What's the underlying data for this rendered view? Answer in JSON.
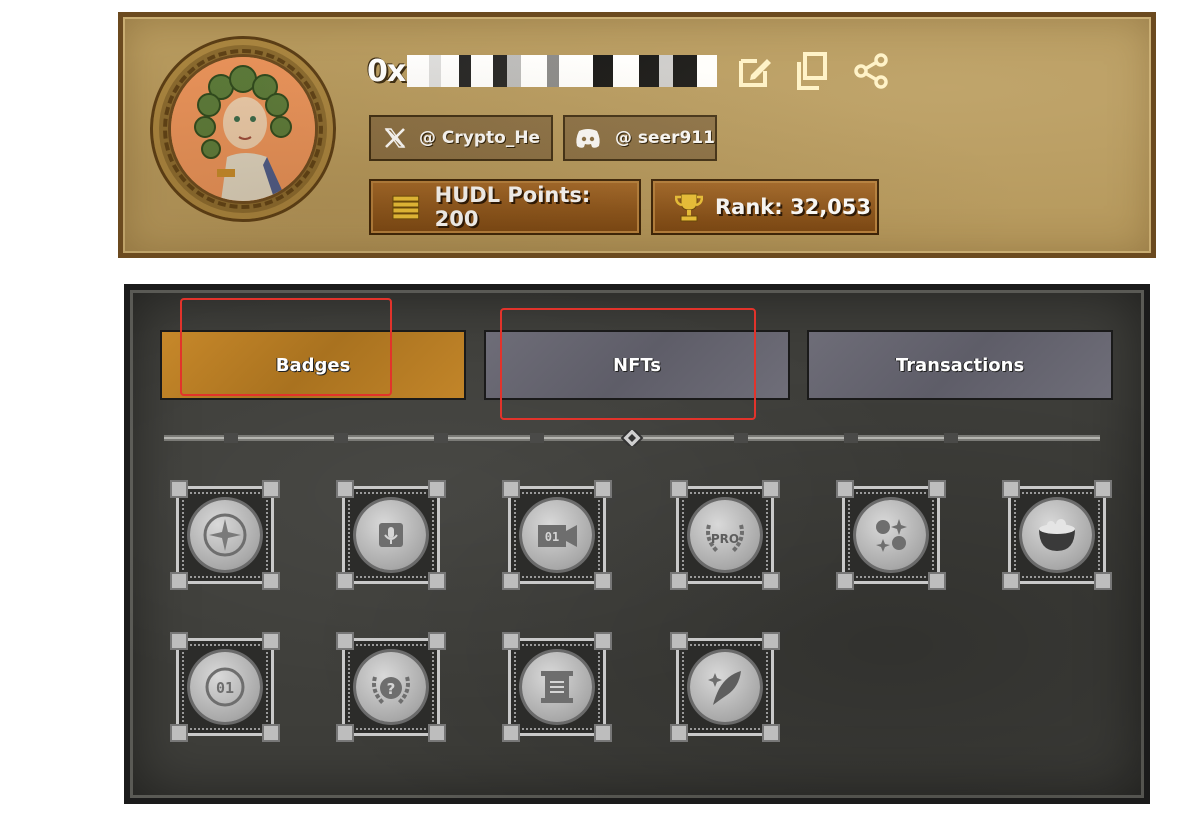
{
  "profile": {
    "address_prefix": "0x",
    "social": [
      {
        "platform": "x",
        "icon": "x-logo-icon",
        "handle": "@ Crypto_He"
      },
      {
        "platform": "discord",
        "icon": "discord-icon",
        "handle": "@ seer911"
      }
    ],
    "stats": [
      {
        "icon": "coins-stack-icon",
        "label": "HUDL Points: 200"
      },
      {
        "icon": "trophy-icon",
        "label": "Rank: 32,053"
      }
    ]
  },
  "tabs": [
    {
      "label": "Badges",
      "active": true
    },
    {
      "label": "NFTs",
      "active": false
    },
    {
      "label": "Transactions",
      "active": false
    }
  ],
  "badges": [
    {
      "icon": "sparkle-badge-icon"
    },
    {
      "icon": "microphone-badge-icon"
    },
    {
      "icon": "video-camera-badge-icon",
      "text": "01"
    },
    {
      "icon": "pro-laurel-badge-icon",
      "text": "PRO"
    },
    {
      "icon": "emotions-badge-icon"
    },
    {
      "icon": "cauldron-badge-icon"
    },
    {
      "icon": "coin-01-badge-icon",
      "text": "01"
    },
    {
      "icon": "question-laurel-badge-icon",
      "text": "?"
    },
    {
      "icon": "scroll-badge-icon"
    },
    {
      "icon": "feather-badge-icon"
    }
  ],
  "colors": {
    "profile_bg": "#b79a5e",
    "tab_active": "#b8792a",
    "tab_inactive": "#66656f",
    "highlight": "#e2332b"
  }
}
